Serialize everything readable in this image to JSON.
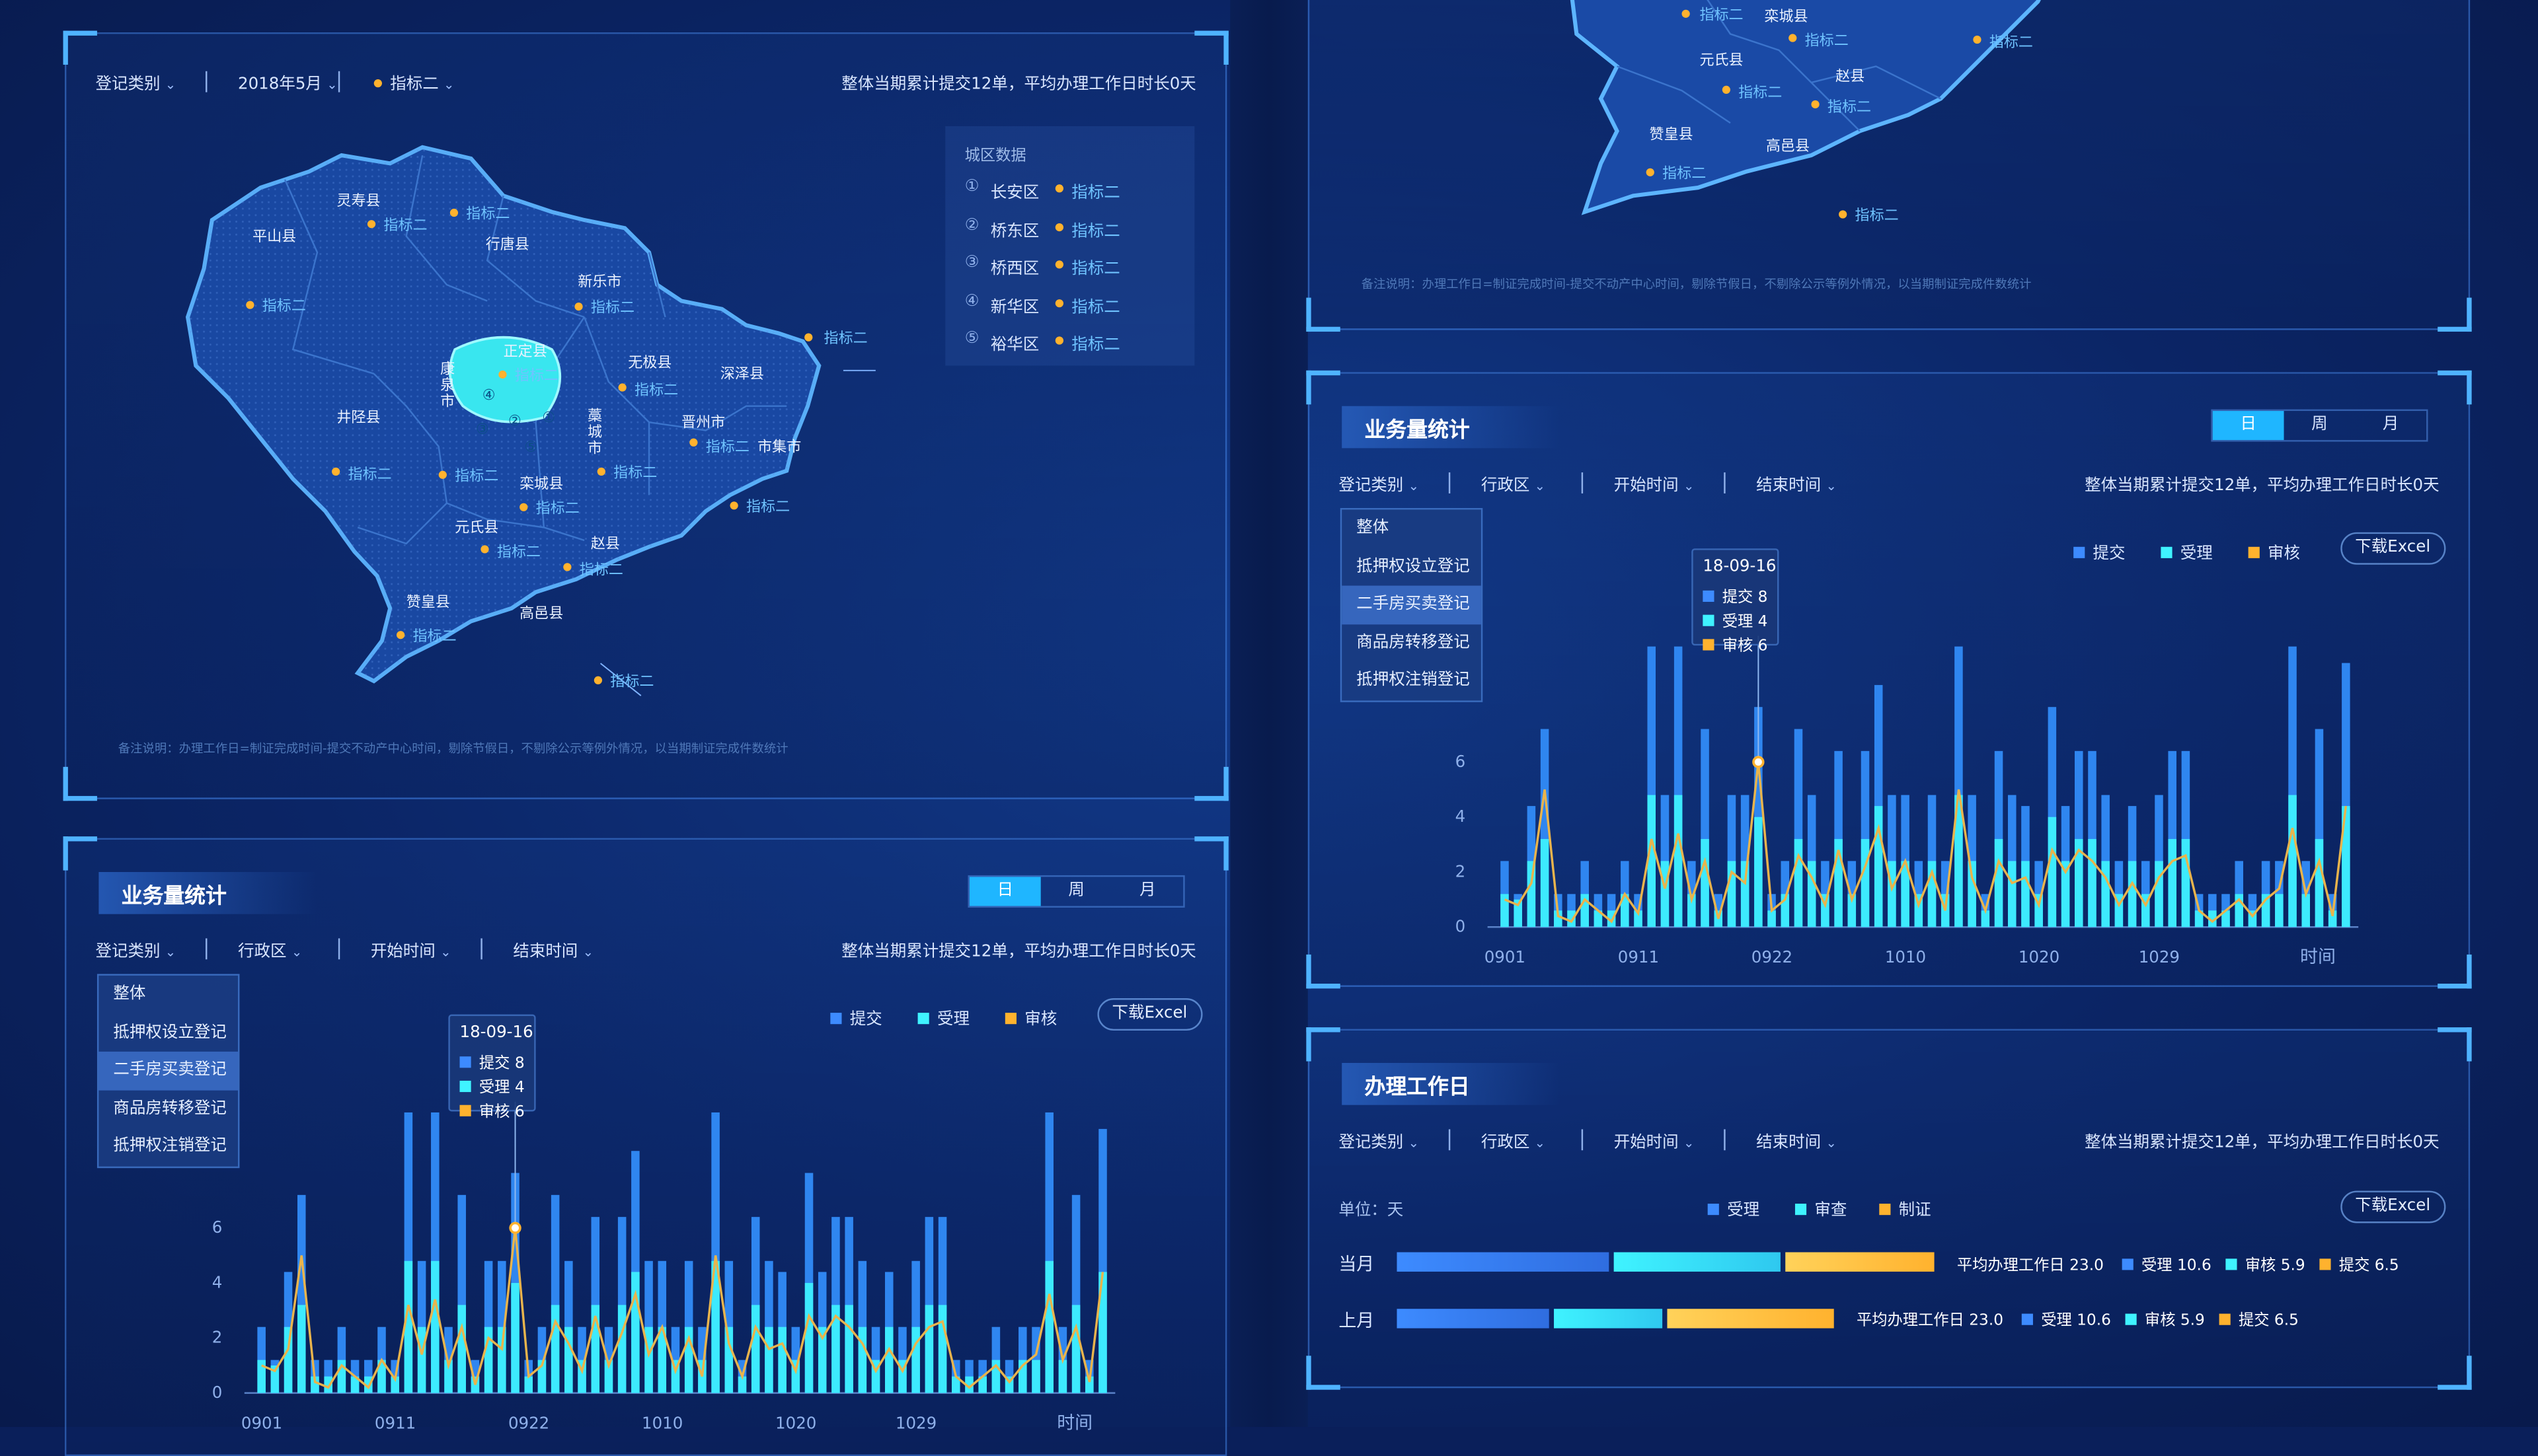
{
  "map_panel": {
    "filters": [
      {
        "label": "登记类别"
      },
      {
        "label": "2018年5月"
      },
      {
        "label": "指标二"
      }
    ],
    "summary": "整体当期累计提交12单，平均办理工作日时长0天",
    "note": "备注说明：办理工作日=制证完成时间-提交不动产中心时间，剔除节假日，不剔除公示等例外情况，以当期制证完成件数统计",
    "city_box": {
      "title": "城区数据",
      "rows": [
        {
          "idx": "①",
          "name": "长安区",
          "value": "指标二"
        },
        {
          "idx": "②",
          "name": "桥东区",
          "value": "指标二"
        },
        {
          "idx": "③",
          "name": "桥西区",
          "value": "指标二"
        },
        {
          "idx": "④",
          "name": "新华区",
          "value": "指标二"
        },
        {
          "idx": "⑤",
          "name": "裕华区",
          "value": "指标二"
        }
      ]
    },
    "counties": [
      "灵寿县",
      "平山县",
      "行唐县",
      "新乐市",
      "正定县",
      "无极县",
      "深泽县",
      "井陉县",
      "康泉市",
      "藁城市",
      "晋州市",
      "市集市",
      "栾城县",
      "元氏县",
      "赵县",
      "赞皇县",
      "高邑县"
    ],
    "indicator": "指标二",
    "district_nums": [
      "①",
      "②",
      "③",
      "④",
      "⑤"
    ]
  },
  "map_panel_top_right": {
    "counties": [
      "栾城县",
      "元氏县",
      "赵县",
      "赞皇县",
      "高邑县"
    ],
    "indicator": "指标二",
    "note": "备注说明：办理工作日=制证完成时间-提交不动产中心时间，剔除节假日，不剔除公示等例外情况，以当期制证完成件数统计"
  },
  "business_panel": {
    "title": "业务量统计",
    "tabs": [
      "日",
      "周",
      "月"
    ],
    "active_tab": "日",
    "filters": [
      {
        "label": "登记类别"
      },
      {
        "label": "行政区"
      },
      {
        "label": "开始时间"
      },
      {
        "label": "结束时间"
      }
    ],
    "summary": "整体当期累计提交12单，平均办理工作日时长0天",
    "dropdown": [
      "整体",
      "抵押权设立登记",
      "二手房买卖登记",
      "商品房转移登记",
      "抵押权注销登记"
    ],
    "dropdown_selected": "二手房买卖登记",
    "legend": [
      {
        "name": "提交",
        "color": "#3d8bff"
      },
      {
        "name": "受理",
        "color": "#3ff3ff"
      },
      {
        "name": "审核",
        "color": "#ffb22e"
      }
    ],
    "excel_button": "下载Excel",
    "tooltip": {
      "date": "18-09-16",
      "rows": [
        "提交 8",
        "受理 4",
        "审核 6"
      ]
    }
  },
  "workday_panel": {
    "title": "办理工作日",
    "filters": [
      {
        "label": "登记类别"
      },
      {
        "label": "行政区"
      },
      {
        "label": "开始时间"
      },
      {
        "label": "结束时间"
      }
    ],
    "summary": "整体当期累计提交12单，平均办理工作日时长0天",
    "unit": "单位：天",
    "legend": [
      {
        "name": "受理",
        "color": "#3d8bff"
      },
      {
        "name": "审查",
        "color": "#3ff3ff"
      },
      {
        "name": "制证",
        "color": "#ffb22e"
      }
    ],
    "excel_button": "下载Excel",
    "rows": [
      {
        "label": "当月",
        "summary": "平均办理工作日 23.0",
        "items": [
          "受理 10.6",
          "审核 5.9",
          "提交 6.5"
        ]
      },
      {
        "label": "上月",
        "summary": "平均办理工作日 23.0",
        "items": [
          "受理 10.6",
          "审核 5.9",
          "提交 6.5"
        ]
      }
    ]
  },
  "chart_data": [
    {
      "type": "bar",
      "title": "业务量统计",
      "x_tick_labels": [
        "0901",
        "0911",
        "0922",
        "1010",
        "1020",
        "1029"
      ],
      "xlabel": "时间",
      "y_tick_labels": [
        "0",
        "2",
        "4",
        "6"
      ],
      "ylim": [
        0,
        10
      ],
      "series": [
        {
          "name": "提交",
          "values": [
            2.4,
            1.2,
            4.4,
            7.2,
            1.2,
            1.2,
            2.4,
            1.2,
            1.2,
            2.4,
            1.2,
            10.2,
            4.8,
            10.2,
            2.4,
            7.2,
            1.2,
            4.8,
            4.8,
            8.0,
            1.2,
            2.4,
            7.2,
            4.8,
            2.4,
            6.4,
            2.4,
            6.4,
            8.8,
            4.8,
            4.8,
            2.4,
            4.8,
            2.4,
            10.2,
            4.8,
            1.2,
            6.4,
            4.8,
            4.4,
            2.4,
            8.0,
            4.4,
            6.4,
            6.4,
            4.8,
            2.4,
            4.4,
            2.4,
            4.8,
            6.4,
            6.4,
            1.2,
            1.2,
            1.2,
            2.4,
            1.2,
            2.4,
            2.4,
            10.2,
            2.4,
            7.2,
            1.2,
            9.6
          ],
          "bar_color": "#3d8bff"
        },
        {
          "name": "受理",
          "values": [
            1.2,
            1.0,
            2.4,
            3.2,
            0.6,
            0.6,
            1.2,
            0.6,
            0.6,
            1.2,
            0.6,
            4.8,
            2.4,
            4.8,
            1.2,
            3.2,
            0.6,
            2.4,
            2.4,
            4.0,
            0.6,
            1.2,
            3.2,
            2.4,
            1.2,
            3.2,
            1.2,
            3.2,
            4.4,
            2.4,
            2.4,
            1.2,
            2.4,
            1.2,
            4.8,
            2.4,
            0.6,
            3.2,
            2.4,
            2.4,
            1.2,
            4.0,
            2.4,
            3.2,
            3.2,
            2.4,
            1.2,
            2.4,
            1.2,
            2.4,
            3.2,
            3.2,
            0.6,
            0.6,
            0.6,
            1.2,
            0.6,
            1.2,
            1.2,
            4.8,
            1.2,
            3.2,
            0.6,
            4.4
          ],
          "bar_color": "#3ff3ff"
        },
        {
          "name": "审核",
          "values": [
            1.0,
            0.8,
            1.6,
            5.0,
            0.4,
            0.2,
            1.0,
            0.6,
            0.2,
            1.2,
            0.5,
            3.2,
            1.4,
            3.4,
            1.0,
            2.4,
            0.3,
            2.0,
            1.6,
            6.0,
            0.6,
            1.0,
            2.6,
            1.8,
            0.8,
            2.8,
            1.0,
            2.2,
            3.6,
            1.4,
            2.4,
            0.8,
            2.0,
            0.6,
            5.0,
            1.8,
            0.6,
            2.4,
            1.6,
            1.8,
            0.8,
            2.8,
            2.0,
            2.8,
            2.4,
            1.8,
            0.8,
            1.6,
            0.8,
            1.8,
            2.4,
            2.6,
            0.6,
            0.2,
            0.6,
            1.0,
            0.4,
            1.0,
            1.4,
            3.6,
            1.2,
            2.4,
            0.4,
            4.4
          ],
          "line_color": "#ffb22e"
        }
      ]
    }
  ]
}
